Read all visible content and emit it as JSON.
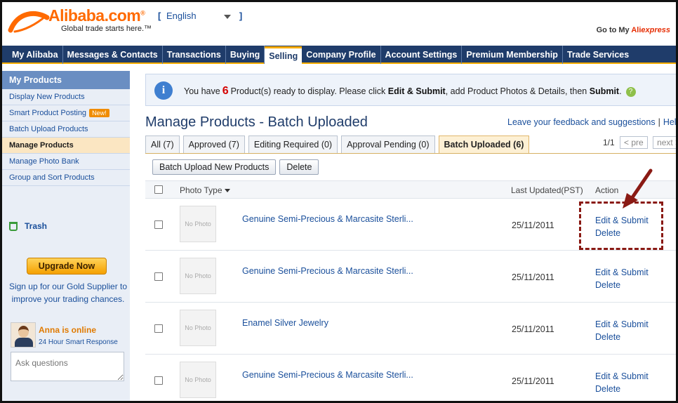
{
  "header": {
    "logo_text": "Alibaba.com",
    "logo_mark": "®",
    "tagline": "Global trade starts here.™",
    "language": {
      "bracket_open": "[",
      "value": "English",
      "bracket_close": "]"
    },
    "goto_label": "Go to My",
    "goto_brand_a": "Ali",
    "goto_brand_b": "express"
  },
  "nav": {
    "items": [
      {
        "label": "My Alibaba"
      },
      {
        "label": "Messages & Contacts"
      },
      {
        "label": "Transactions"
      },
      {
        "label": "Buying"
      },
      {
        "label": "Selling"
      },
      {
        "label": "Company Profile"
      },
      {
        "label": "Account Settings"
      },
      {
        "label": "Premium Membership"
      },
      {
        "label": "Trade Services"
      }
    ],
    "active": "Selling"
  },
  "sidebar": {
    "heading": "My Products",
    "items": [
      {
        "label": "Display New Products"
      },
      {
        "label": "Smart Product Posting",
        "badge": "New!"
      },
      {
        "label": "Batch Upload Products"
      },
      {
        "label": "Manage Products"
      },
      {
        "label": "Manage Photo Bank"
      },
      {
        "label": "Group and Sort Products"
      }
    ],
    "active": "Manage Products",
    "trash_label": "Trash",
    "upgrade_label": "Upgrade Now",
    "signup_text": "Sign up for our Gold Supplier to improve your trading chances.",
    "agent_status": "Anna is online",
    "agent_sub": "24 Hour Smart Response",
    "ask_placeholder": "Ask questions"
  },
  "notice": {
    "prefix": "You have",
    "count": "6",
    "middle": "Product(s) ready to display. Please click",
    "bold1": "Edit & Submit",
    "middle2": ", add Product Photos & Details, then",
    "bold2": "Submit",
    "suffix": ".",
    "help": "?"
  },
  "main": {
    "title": "Manage Products - Batch Uploaded",
    "feedback_link": "Leave your feedback and suggestions",
    "separator": "|",
    "help_link": "Help",
    "tabs": [
      {
        "label": "All (7)"
      },
      {
        "label": "Approved (7)"
      },
      {
        "label": "Editing Required (0)"
      },
      {
        "label": "Approval Pending (0)"
      },
      {
        "label": "Batch Uploaded (6)"
      }
    ],
    "active_tab": "Batch Uploaded (6)",
    "pager": {
      "page": "1/1",
      "prev": "< pre",
      "next": "next >"
    },
    "buttons": {
      "batch_upload": "Batch Upload New Products",
      "delete": "Delete"
    }
  },
  "table": {
    "columns": {
      "photo": "Photo Type",
      "updated": "Last Updated(PST)",
      "action": "Action"
    },
    "rows": [
      {
        "photo": "No Photo",
        "name": "Genuine Semi-Precious & Marcasite Sterli...",
        "date": "25/11/2011",
        "edit": "Edit & Submit",
        "delete": "Delete"
      },
      {
        "photo": "No Photo",
        "name": "Genuine Semi-Precious & Marcasite Sterli...",
        "date": "25/11/2011",
        "edit": "Edit & Submit",
        "delete": "Delete"
      },
      {
        "photo": "No Photo",
        "name": "Enamel Silver Jewelry",
        "date": "25/11/2011",
        "edit": "Edit & Submit",
        "delete": "Delete"
      },
      {
        "photo": "No Photo",
        "name": "Genuine Semi-Precious & Marcasite Sterli...",
        "date": "25/11/2011",
        "edit": "Edit & Submit",
        "delete": "Delete"
      }
    ]
  },
  "colors": {
    "brand_orange": "#ff6a00",
    "nav_blue": "#1f3c6a",
    "link_blue": "#1a4f9b",
    "highlight_red": "#8a1a14"
  }
}
